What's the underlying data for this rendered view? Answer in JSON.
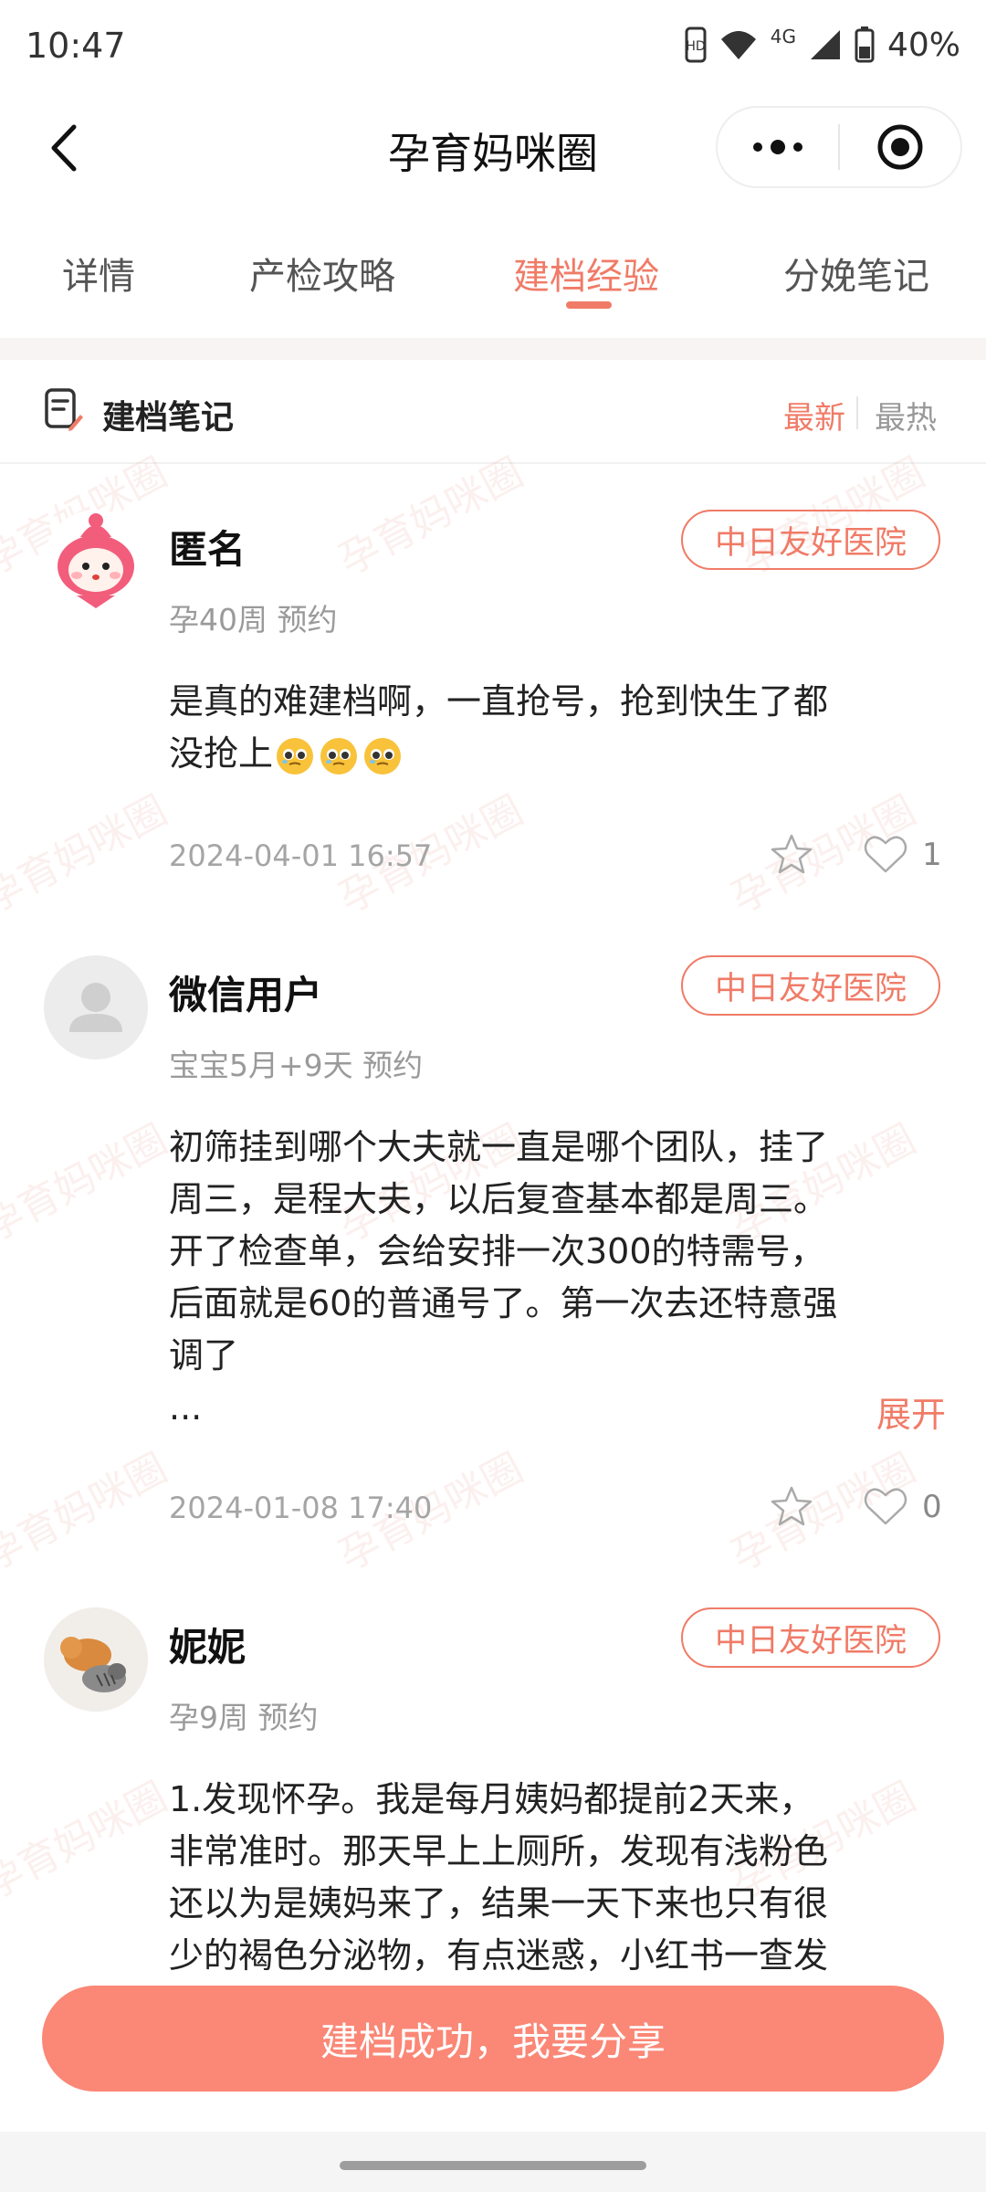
{
  "status_bar": {
    "time": "10:47",
    "network": "4G",
    "battery": "40%",
    "icons": [
      "hd-icon",
      "wifi-icon",
      "signal-icon",
      "battery-icon"
    ]
  },
  "header": {
    "title": "孕育妈咪圈",
    "back_icon": "chevron-left-icon",
    "more_icon": "more-dots-icon",
    "close_icon": "target-circle-icon"
  },
  "tabs": [
    {
      "label": "详情",
      "active": false
    },
    {
      "label": "产检攻略",
      "active": false
    },
    {
      "label": "建档经验",
      "active": true
    },
    {
      "label": "分娩笔记",
      "active": false
    }
  ],
  "section": {
    "icon": "note-edit-icon",
    "title": "建档笔记",
    "sort_newest": "最新",
    "sort_hot": "最热",
    "active_sort": "最新"
  },
  "watermark_text": "孕育妈咪圈",
  "posts": [
    {
      "avatar": "cartoon-avatar",
      "username": "匿名",
      "hospital": "中日友好医院",
      "meta": "孕40周 预约",
      "lines": [
        "是真的难建档啊，一直抢号，抢到快生了都",
        "没抢上"
      ],
      "emoji_count": 3,
      "time": "2024-04-01 16:57",
      "likes": "1"
    },
    {
      "avatar": "default-user-avatar",
      "username": "微信用户",
      "hospital": "中日友好医院",
      "meta": "宝宝5月+9天 预约",
      "lines": [
        "初筛挂到哪个大夫就一直是哪个团队，挂了",
        "周三，是程大夫，以后复查基本都是周三。",
        "开了检查单，会给安排一次300的特需号，",
        "后面就是60的普通号了。第一次去还特意强",
        "调了",
        "..."
      ],
      "expand": "展开",
      "time": "2024-01-08 17:40",
      "likes": "0"
    },
    {
      "avatar": "cat-photo-avatar",
      "username": "妮妮",
      "hospital": "中日友好医院",
      "meta": "孕9周 预约",
      "lines": [
        "1.发现怀孕。我是每月姨妈都提前2天来，",
        "非常准时。那天早上上厕所，发现有浅粉色",
        "还以为是姨妈来了，结果一天下来也只有很",
        "少的褐色分泌物，有点迷惑，小红书一查发"
      ]
    }
  ],
  "cta": {
    "label": "建档成功，我要分享"
  },
  "colors": {
    "accent": "#f07b67",
    "cta": "#fb8776"
  }
}
